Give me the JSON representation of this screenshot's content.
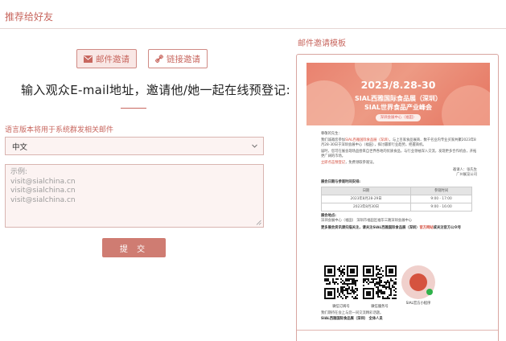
{
  "header": {
    "title": "推荐给好友"
  },
  "tabs": [
    {
      "label": "邮件邀请",
      "icon": "mail-icon",
      "active": true
    },
    {
      "label": "链接邀请",
      "icon": "link-icon",
      "active": false
    }
  ],
  "form": {
    "headline": "输入观众E-mail地址，邀请他/她一起在线预登记:",
    "lang_note": "语言版本将用于系统群发相关邮件",
    "lang_selected": "中文",
    "emails_placeholder_lines": [
      "示例:",
      "visit@sialchina.cn",
      "visit@sialchina.cn",
      "visit@sialchina.cn"
    ],
    "submit_label": "提 交"
  },
  "template": {
    "title": "邮件邀请模板",
    "banner": {
      "date": "2023/8.28-30",
      "line1": "SIAL西雅国际食品展（深圳）",
      "line2": "SIAL世界食品产业峰会",
      "pill": "深圳会展中心（福田）"
    },
    "letter": {
      "greeting": "尊敬的先生：",
      "para1_a": "我们诚邀您参加",
      "para1_hl": "SIAL西雅国际食品展（深圳）",
      "para1_b": "，与上百家食品展商、数千名业内专业买家共聚2023年8月28-30日于深圳会展中心（福田），探讨最新行业趋势，把握商机。",
      "para2": "届时，您可在展会现场品尝来自世界各地的优质食品，与行业领袖深入交流，发现更多合作机会，开拓更广阔的市场。",
      "link_line_hl": "立即点击预登记",
      "link_line_b": "，免费领取参观证。",
      "sign1": "邀请人：张先生",
      "sign2": "广州展览公司",
      "schedule_title": "展会日期与参观时间安排:",
      "schedule_headers": [
        "日期",
        "参观时间"
      ],
      "schedule_rows": [
        [
          "2023年8月28-29日",
          "9:00 - 17:00"
        ],
        [
          "2023年8月30日",
          "9:00 - 16:00"
        ]
      ],
      "venue_title": "展会地点:",
      "venue_text": "深圳会展中心（福田）  深圳市福田区福华三路深圳会展中心",
      "follow_a": "更多展会资讯请扫描关注，请关注SIAL西雅国际食品展（深圳）",
      "follow_hl": "官方网站",
      "follow_b": "或关注官方公众号"
    },
    "qr": [
      {
        "caption": "微信订阅号"
      },
      {
        "caption": "微信服务号"
      },
      {
        "caption": "SIAL官方小程序"
      }
    ],
    "footer": {
      "line1": "我们期待在会上与您一同交流精彩话题。",
      "line2": "SIAL西雅国际食品展（深圳） 全体人员"
    }
  },
  "colors": {
    "accent": "#c8675f",
    "field_bg": "#fcf3f2",
    "button": "#cf7c72"
  }
}
